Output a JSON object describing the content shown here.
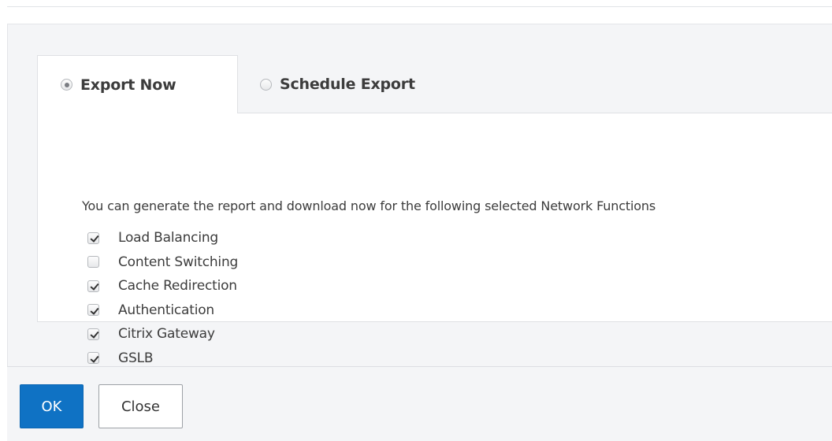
{
  "tabs": [
    {
      "label": "Export Now",
      "selected": true
    },
    {
      "label": "Schedule Export",
      "selected": false
    }
  ],
  "intro_text": "You can generate the report and download now for the following selected Network Functions",
  "functions": [
    {
      "label": "Load Balancing",
      "checked": true
    },
    {
      "label": "Content Switching",
      "checked": false
    },
    {
      "label": "Cache Redirection",
      "checked": true
    },
    {
      "label": "Authentication",
      "checked": true
    },
    {
      "label": "Citrix Gateway",
      "checked": true
    },
    {
      "label": "GSLB",
      "checked": true
    }
  ],
  "buttons": {
    "ok_label": "OK",
    "close_label": "Close"
  },
  "colors": {
    "primary": "#0f72c4",
    "panel_bg": "#f4f5f7",
    "border": "#dfe1e4",
    "text": "#3c3c3c"
  }
}
